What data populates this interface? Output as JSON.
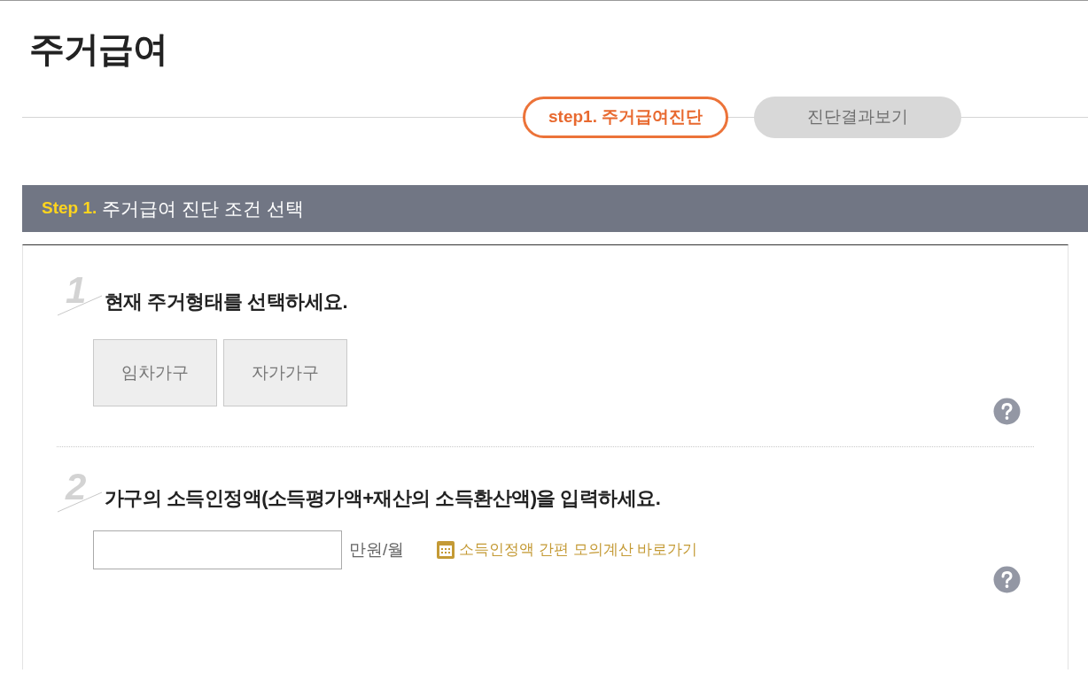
{
  "page_title": "주거급여",
  "steps": [
    {
      "label": "step1. 주거급여진단",
      "selected": true
    },
    {
      "label": "진단결과보기",
      "selected": false
    }
  ],
  "section_header": {
    "step": "Step 1.",
    "title": "주거급여 진단 조건 선택"
  },
  "questions": [
    {
      "kind": "choice",
      "number": "1",
      "heading": "현재 주거형태를 선택하세요.",
      "options": [
        {
          "label": "임차가구",
          "selected": false
        },
        {
          "label": "자가가구",
          "selected": false
        }
      ]
    },
    {
      "kind": "amount",
      "number": "2",
      "heading": "가구의 소득인정액(소득평가액+재산의 소득환산액)을 입력하세요.",
      "unit": "만원/월",
      "link": "소득인정액 간편 모의계산 바로가기"
    }
  ]
}
